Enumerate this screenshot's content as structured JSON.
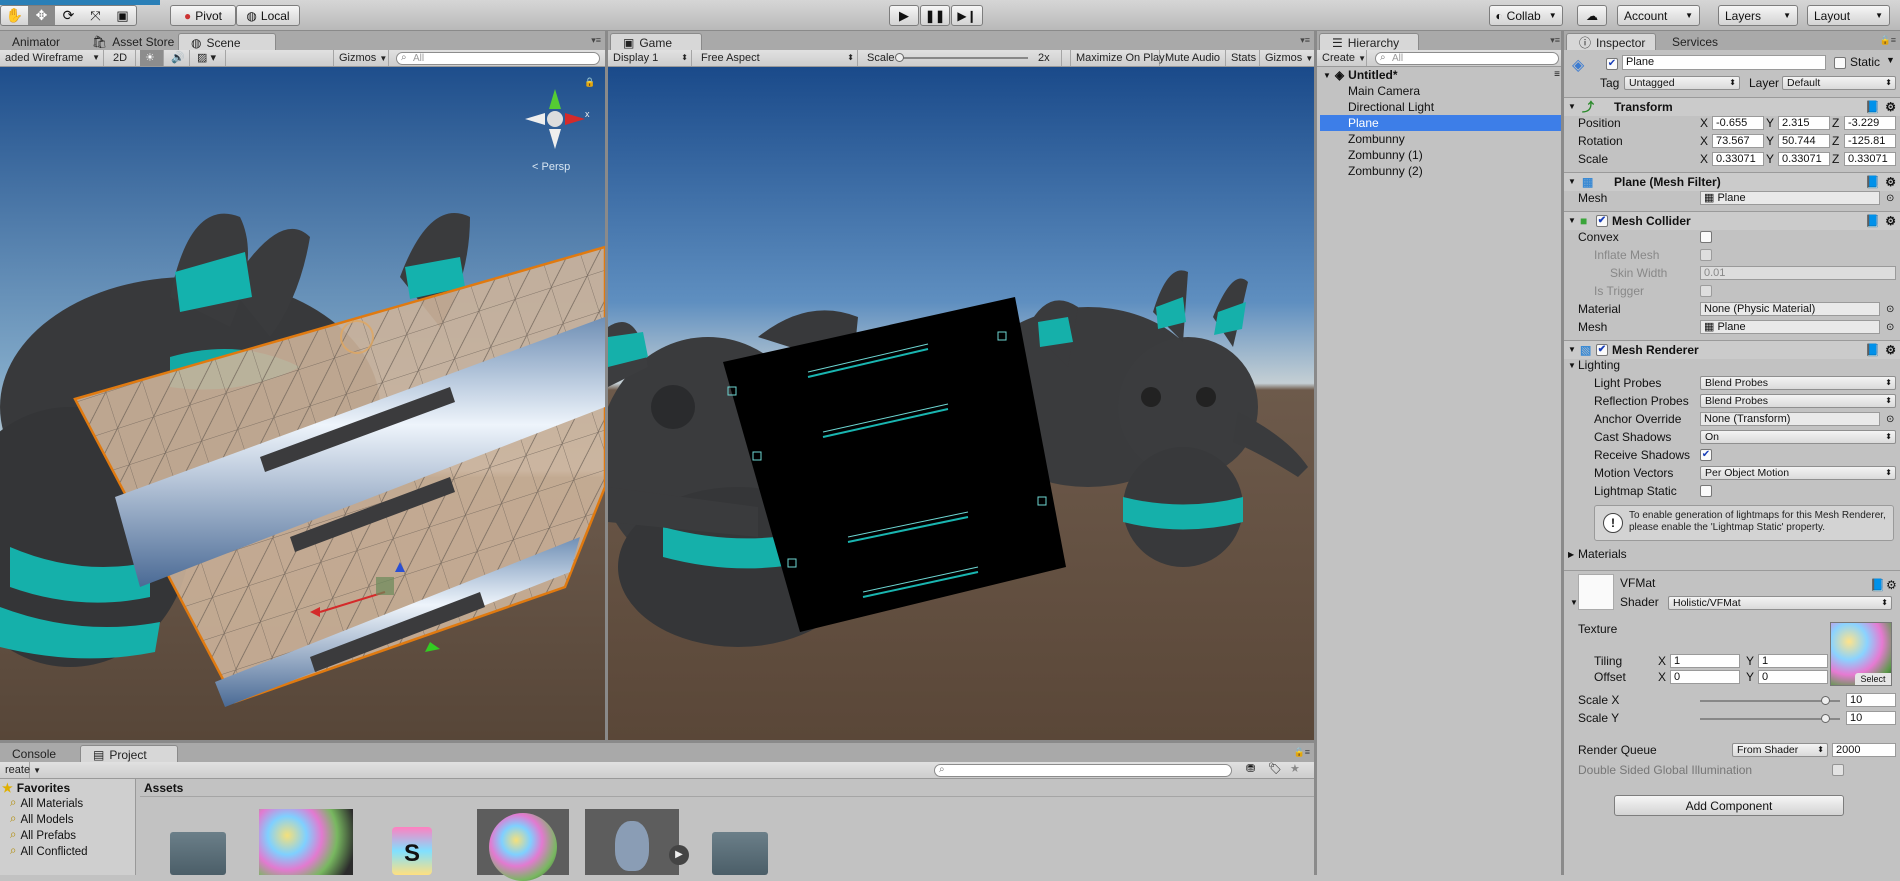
{
  "toolbar": {
    "pivot": "Pivot",
    "local": "Local",
    "collab": "Collab",
    "account": "Account",
    "layers": "Layers",
    "layout": "Layout"
  },
  "scene": {
    "tabs": [
      "Animator",
      "Asset Store",
      "Scene"
    ],
    "shading": "aded Wireframe",
    "mode_2d": "2D",
    "gizmos": "Gizmos",
    "search_placeholder": "All",
    "persp": "Persp"
  },
  "game": {
    "tab": "Game",
    "display": "Display 1",
    "aspect": "Free Aspect",
    "scale_label": "Scale",
    "scale_value": "2x",
    "scale_fraction": 0.0,
    "maximize": "Maximize On Play",
    "mute": "Mute Audio",
    "stats": "Stats",
    "gizmos": "Gizmos"
  },
  "hierarchy": {
    "tab": "Hierarchy",
    "create": "Create",
    "search_placeholder": "All",
    "scene_name": "Untitled*",
    "items": [
      "Main Camera",
      "Directional Light",
      "Plane",
      "Zombunny",
      "Zombunny (1)",
      "Zombunny (2)"
    ],
    "selected_index": 2
  },
  "inspector": {
    "tabs": [
      "Inspector",
      "Services"
    ],
    "object_name": "Plane",
    "static_label": "Static",
    "tag_label": "Tag",
    "tag_value": "Untagged",
    "layer_label": "Layer",
    "layer_value": "Default",
    "transform": {
      "title": "Transform",
      "position_label": "Position",
      "rotation_label": "Rotation",
      "scale_label": "Scale",
      "position": [
        "-0.655",
        "2.315",
        "-3.229"
      ],
      "rotation": [
        "73.567",
        "50.744",
        "-125.81"
      ],
      "scale": [
        "0.33071",
        "0.33071",
        "0.33071"
      ],
      "axis": [
        "X",
        "Y",
        "Z"
      ]
    },
    "mesh_filter": {
      "title": "Plane (Mesh Filter)",
      "mesh_label": "Mesh",
      "mesh_value": "Plane"
    },
    "mesh_collider": {
      "title": "Mesh Collider",
      "convex": "Convex",
      "inflate": "Inflate Mesh",
      "skin_width": "Skin Width",
      "skin_value": "0.01",
      "is_trigger": "Is Trigger",
      "material_label": "Material",
      "material_value": "None (Physic Material)",
      "mesh_label": "Mesh",
      "mesh_value": "Plane"
    },
    "mesh_renderer": {
      "title": "Mesh Renderer",
      "lighting": "Lighting",
      "light_probes": "Light Probes",
      "light_probes_value": "Blend Probes",
      "reflection_probes": "Reflection Probes",
      "reflection_probes_value": "Blend Probes",
      "anchor_override": "Anchor Override",
      "anchor_value": "None (Transform)",
      "cast_shadows": "Cast Shadows",
      "cast_value": "On",
      "receive_shadows": "Receive Shadows",
      "motion_vectors": "Motion Vectors",
      "motion_value": "Per Object Motion",
      "lightmap_static": "Lightmap Static",
      "info": "To enable generation of lightmaps for this Mesh Renderer, please enable the 'Lightmap Static' property.",
      "materials": "Materials"
    },
    "material": {
      "name": "VFMat",
      "shader_label": "Shader",
      "shader_value": "Holistic/VFMat",
      "texture": "Texture",
      "tiling": "Tiling",
      "offset": "Offset",
      "tiling_x": "1",
      "tiling_y": "1",
      "offset_x": "0",
      "offset_y": "0",
      "select": "Select",
      "scale_x_label": "Scale X",
      "scale_x": "10",
      "scale_y_label": "Scale Y",
      "scale_y": "10",
      "render_queue": "Render Queue",
      "render_queue_mode": "From Shader",
      "render_queue_value": "2000",
      "double_sided": "Double Sided Global Illumination"
    },
    "add_component": "Add Component"
  },
  "project": {
    "tabs": [
      "Console",
      "Project"
    ],
    "create": "reate",
    "favorites": "Favorites",
    "fav_items": [
      "All Materials",
      "All Models",
      "All Prefabs",
      "All Conflicted"
    ],
    "assets": "Assets"
  },
  "colors": {
    "selection": "#3d7ee8",
    "teal": "#19b5b0",
    "sky_top": "#1f4f8a",
    "ground": "#5e4a3c"
  }
}
